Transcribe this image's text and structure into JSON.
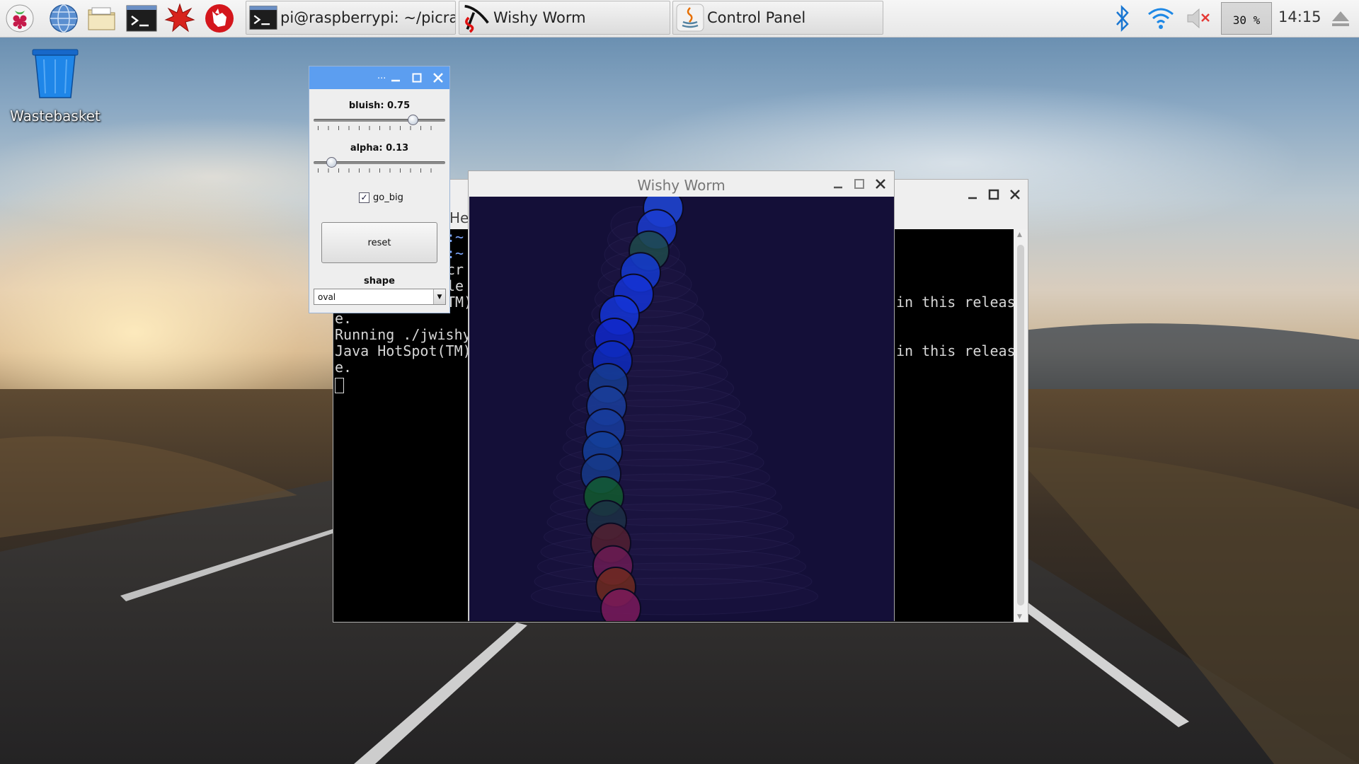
{
  "taskbar": {
    "launchers": [
      {
        "name": "raspberry-menu-icon"
      },
      {
        "name": "web-browser-icon"
      },
      {
        "name": "file-manager-icon"
      },
      {
        "name": "terminal-icon"
      },
      {
        "name": "mathematica-icon"
      },
      {
        "name": "wolfram-icon"
      }
    ],
    "tasks": {
      "terminal": "pi@raspberrypi: ~/picrat...",
      "wishy_worm": "Wishy Worm",
      "control_panel": "Control Panel"
    },
    "tray": {
      "cpu": "30 %",
      "clock": "14:15"
    }
  },
  "desktop": {
    "wastebasket_label": "Wastebasket"
  },
  "terminal": {
    "partial_title": "He",
    "left_lines": [
      ":~",
      ":~",
      "cr",
      "le",
      "TM)"
    ],
    "line_e1": "e.",
    "line_running": "Running ./jwishy",
    "line_java": "Java HotSpot(TM)",
    "line_e2": "e.",
    "right_line1": "in this releas",
    "right_line2": "in this releas"
  },
  "wishy_worm": {
    "title": "Wishy Worm"
  },
  "control_panel": {
    "title_dots": "...",
    "bluish_label": "bluish: 0.75",
    "bluish_value": 0.75,
    "alpha_label": "alpha: 0.13",
    "alpha_value": 0.13,
    "go_big_label": "go_big",
    "go_big_checked": "✓",
    "reset_label": "reset",
    "shape_label": "shape",
    "shape_value": "oval"
  }
}
